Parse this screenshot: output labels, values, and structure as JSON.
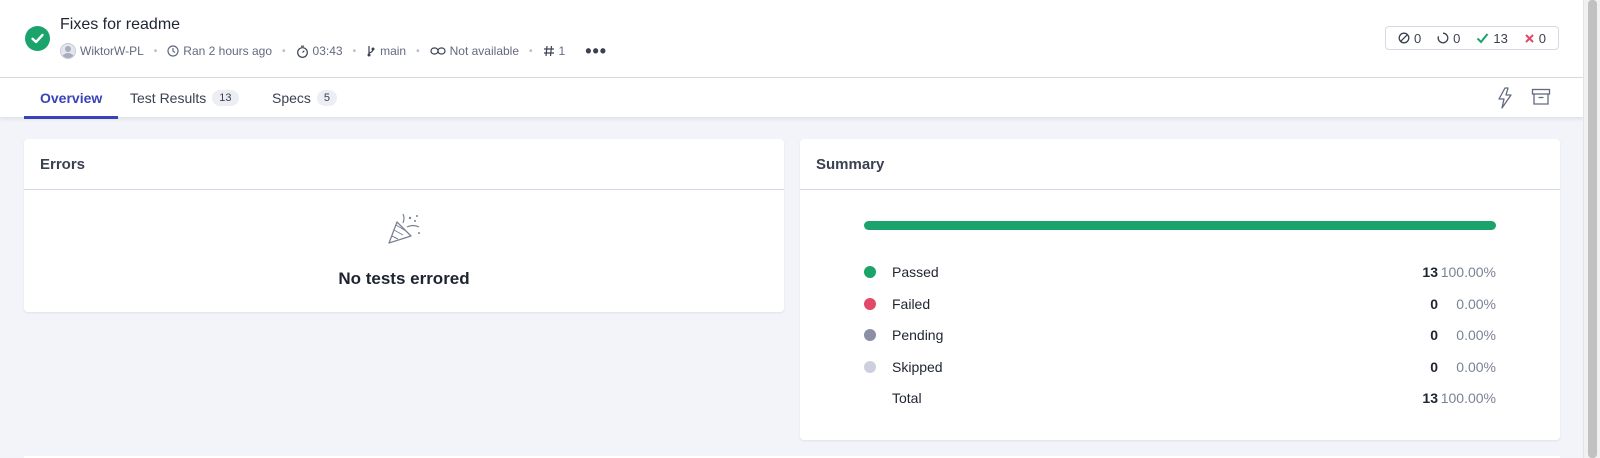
{
  "header": {
    "title": "Fixes for readme",
    "author": "WiktorW-PL",
    "ran": "Ran 2 hours ago",
    "duration": "03:43",
    "branch": "main",
    "link": "Not available",
    "run_number": "1"
  },
  "counts": {
    "skipped": "0",
    "pending": "0",
    "passed": "13",
    "failed": "0"
  },
  "tabs": [
    {
      "label": "Overview"
    },
    {
      "label": "Test Results",
      "badge": "13"
    },
    {
      "label": "Specs",
      "badge": "5"
    }
  ],
  "errors": {
    "title": "Errors",
    "empty_text": "No tests errored"
  },
  "summary": {
    "title": "Summary",
    "progress_passed_fraction": 1.0,
    "rows": [
      {
        "label": "Passed",
        "count": "13",
        "pct": "100.00%",
        "color": "#1aa36b"
      },
      {
        "label": "Failed",
        "count": "0",
        "pct": "0.00%",
        "color": "#e2486a"
      },
      {
        "label": "Pending",
        "count": "0",
        "pct": "0.00%",
        "color": "#8a8fa3"
      },
      {
        "label": "Skipped",
        "count": "0",
        "pct": "0.00%",
        "color": "#cdd0dc"
      },
      {
        "label": "Total",
        "count": "13",
        "pct": "100.00%",
        "color": ""
      }
    ]
  },
  "colors": {
    "accent": "#3943b7",
    "success": "#1aa36b",
    "failure": "#e2486a"
  }
}
